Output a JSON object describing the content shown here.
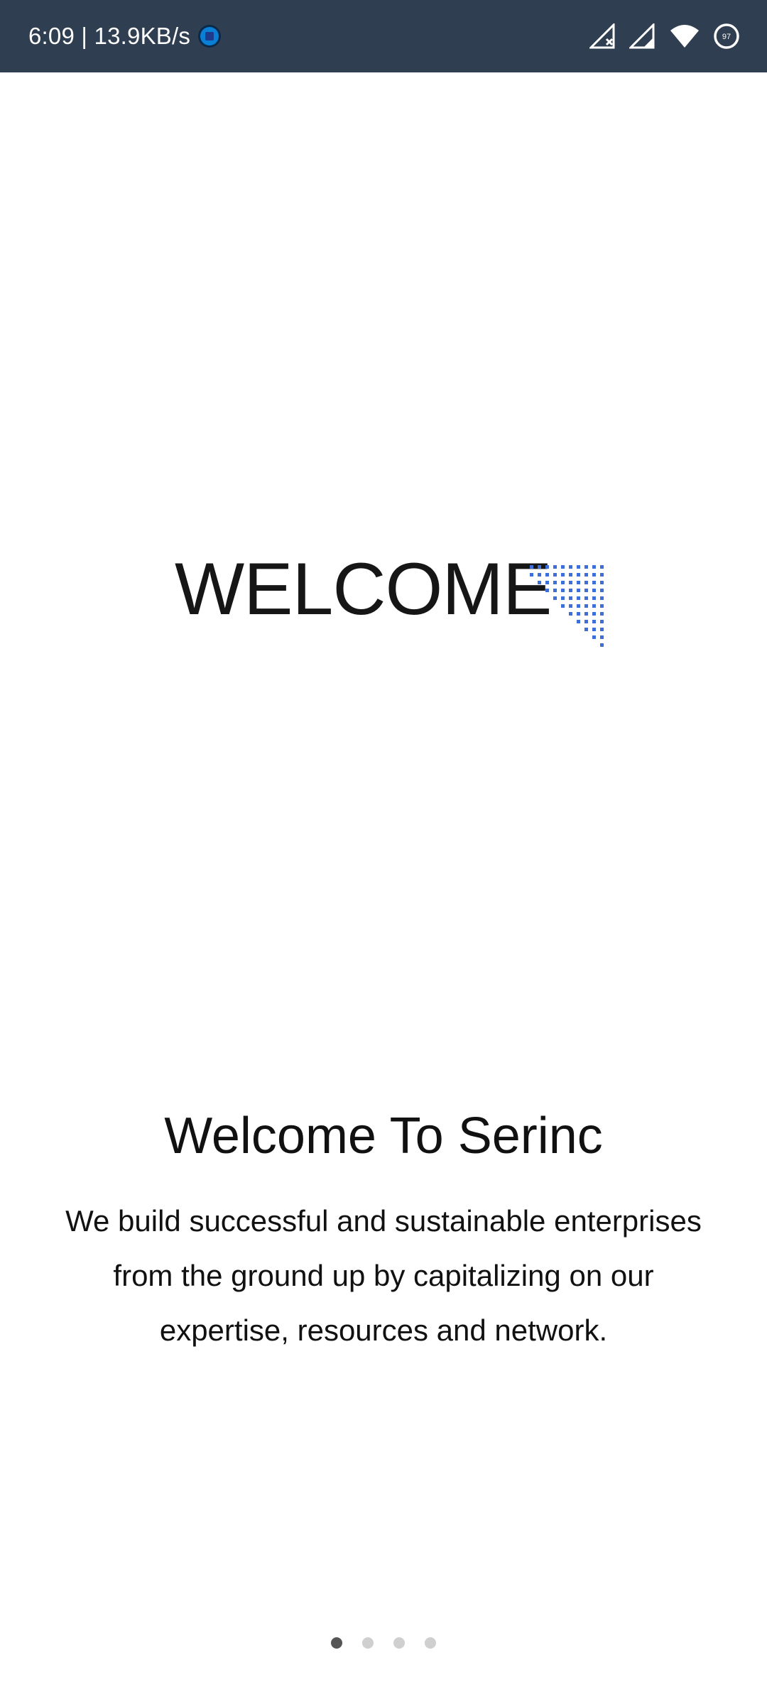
{
  "status_bar": {
    "time_speed": "6:09 | 13.9KB/s",
    "battery": "97",
    "icons": [
      "notification-app-icon",
      "signal-off-icon",
      "signal-icon",
      "wifi-icon",
      "battery-icon"
    ]
  },
  "logo": {
    "text": "WELCOME",
    "accent_color": "#3d6fd8"
  },
  "intro": {
    "title": "Welcome To Serinc",
    "description": "We build successful and sustainable enterprises from the ground up by capitalizing on our expertise, resources and network."
  },
  "pager": {
    "count": 4,
    "active_index": 0,
    "active_color": "#555555",
    "inactive_color": "#cfcfcf"
  }
}
